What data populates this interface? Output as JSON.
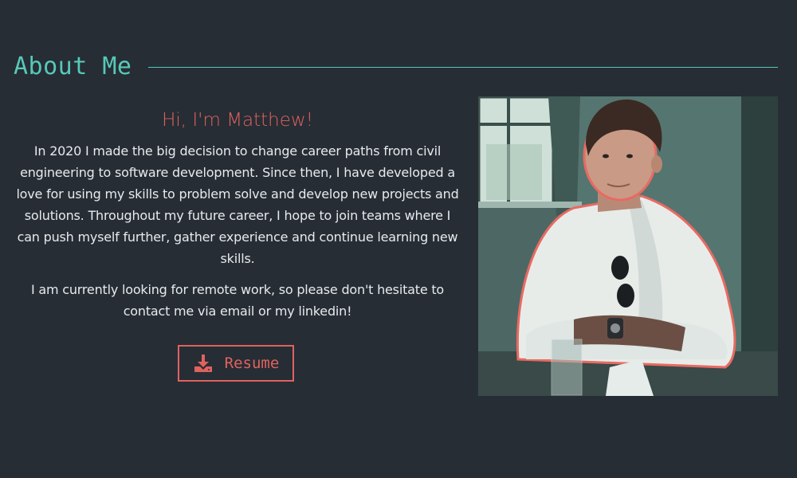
{
  "section": {
    "title": "About Me"
  },
  "about": {
    "greeting": "Hi, I'm Matthew!",
    "paragraphs": [
      "In 2020 I made the big decision to change career paths from civil engineering to software development. Since then, I have developed a love for using my skills to problem solve and develop new projects and solutions. Throughout my future career, I hope to join teams where I can push myself further, gather experience and continue learning new skills.",
      "I am currently looking for remote work, so please don't hesitate to contact me via email or my linkedin!"
    ]
  },
  "resume_button": {
    "label": "Resume",
    "icon": "download-icon"
  },
  "photo": {
    "subject": "portrait photo"
  },
  "colors": {
    "background": "#262d35",
    "accent_teal": "#58c8b8",
    "accent_red": "#e0625e",
    "text": "#e8eaec"
  }
}
